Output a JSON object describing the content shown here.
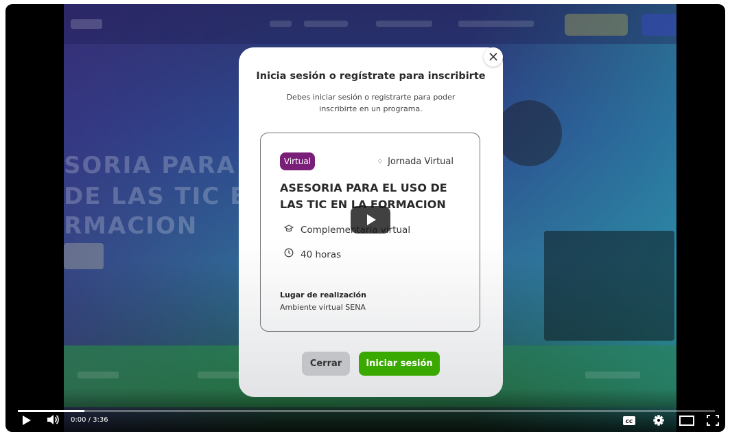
{
  "background_video": {
    "headline_lines": [
      "SORIA PARA E",
      "DE LAS TIC E",
      "RMACION"
    ]
  },
  "modal": {
    "close_glyph": "×",
    "title": "Inicia sesión o regístrate para inscribirte",
    "subtitle": "Debes iniciar sesión o registrarte para poder inscribirte en un programa.",
    "card": {
      "tag": "Virtual",
      "schedule": "Jornada Virtual",
      "program_title": "ASESORIA PARA EL USO DE LAS TIC EN LA FORMACION",
      "type": "Complementaria virtual",
      "duration": "40 horas",
      "location_label": "Lugar de realización",
      "location_value": "Ambiente virtual SENA"
    },
    "buttons": {
      "close": "Cerrar",
      "login": "Iniciar sesión"
    }
  },
  "player": {
    "time": "0:00 / 3:36",
    "progress_fraction": 0.095,
    "icons": [
      "play-icon",
      "volume-icon",
      "captions-icon",
      "settings-icon",
      "theater-icon",
      "fullscreen-icon"
    ],
    "captions_label": "CC"
  },
  "colors": {
    "accent_green": "#39a900",
    "tag_purple": "#7a1f78"
  }
}
